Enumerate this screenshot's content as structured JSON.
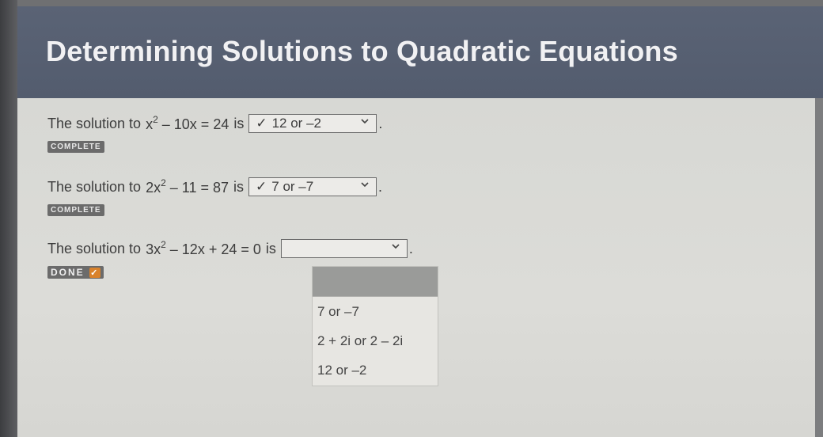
{
  "header": {
    "title": "Determining Solutions to Quadratic Equations"
  },
  "questions": [
    {
      "prefix": "The solution to",
      "equation_parts": [
        "x",
        "2",
        " – 10x = 24"
      ],
      "suffix": "is",
      "selected": "12 or –2",
      "checked": "✓",
      "status": "COMPLETE"
    },
    {
      "prefix": "The solution to",
      "equation_parts": [
        "2x",
        "2",
        " – 11 = 87"
      ],
      "suffix": "is",
      "selected": "7 or –7",
      "checked": "✓",
      "status": "COMPLETE"
    },
    {
      "prefix": "The solution to",
      "equation_parts": [
        "3x",
        "2",
        " – 12x + 24 = 0"
      ],
      "suffix": "is",
      "selected": "",
      "status": "DONE",
      "status_check": "✓"
    }
  ],
  "dropdown": {
    "options": [
      "7 or –7",
      "2 + 2i or 2 – 2i",
      "12 or –2"
    ]
  },
  "icons": {
    "chevron": "chevron-down-icon",
    "check": "check-icon"
  },
  "colors": {
    "header_bg": "#566073",
    "content_bg": "#d9d9d5",
    "done_accent": "#d9822b"
  }
}
